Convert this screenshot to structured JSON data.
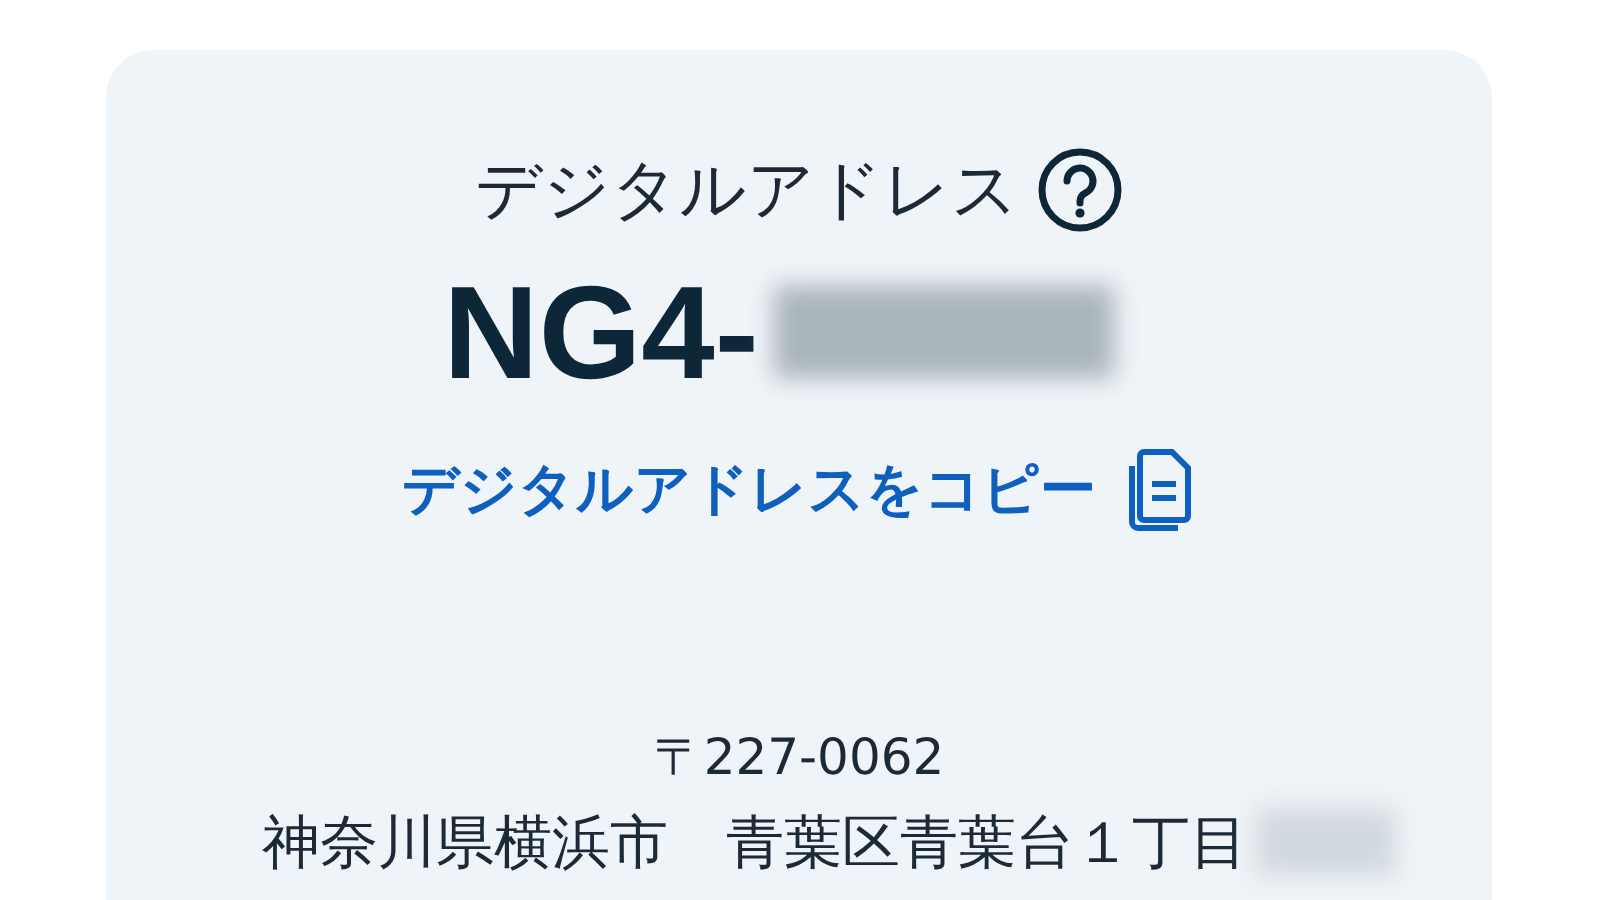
{
  "card": {
    "title": "デジタルアドレス",
    "code_prefix": "NG4-",
    "code_redacted": true,
    "copy_link": "デジタルアドレスをコピー",
    "postal_code": "〒227-0062",
    "address": "神奈川県横浜市　青葉区青葉台１丁目",
    "address_redacted": true
  }
}
